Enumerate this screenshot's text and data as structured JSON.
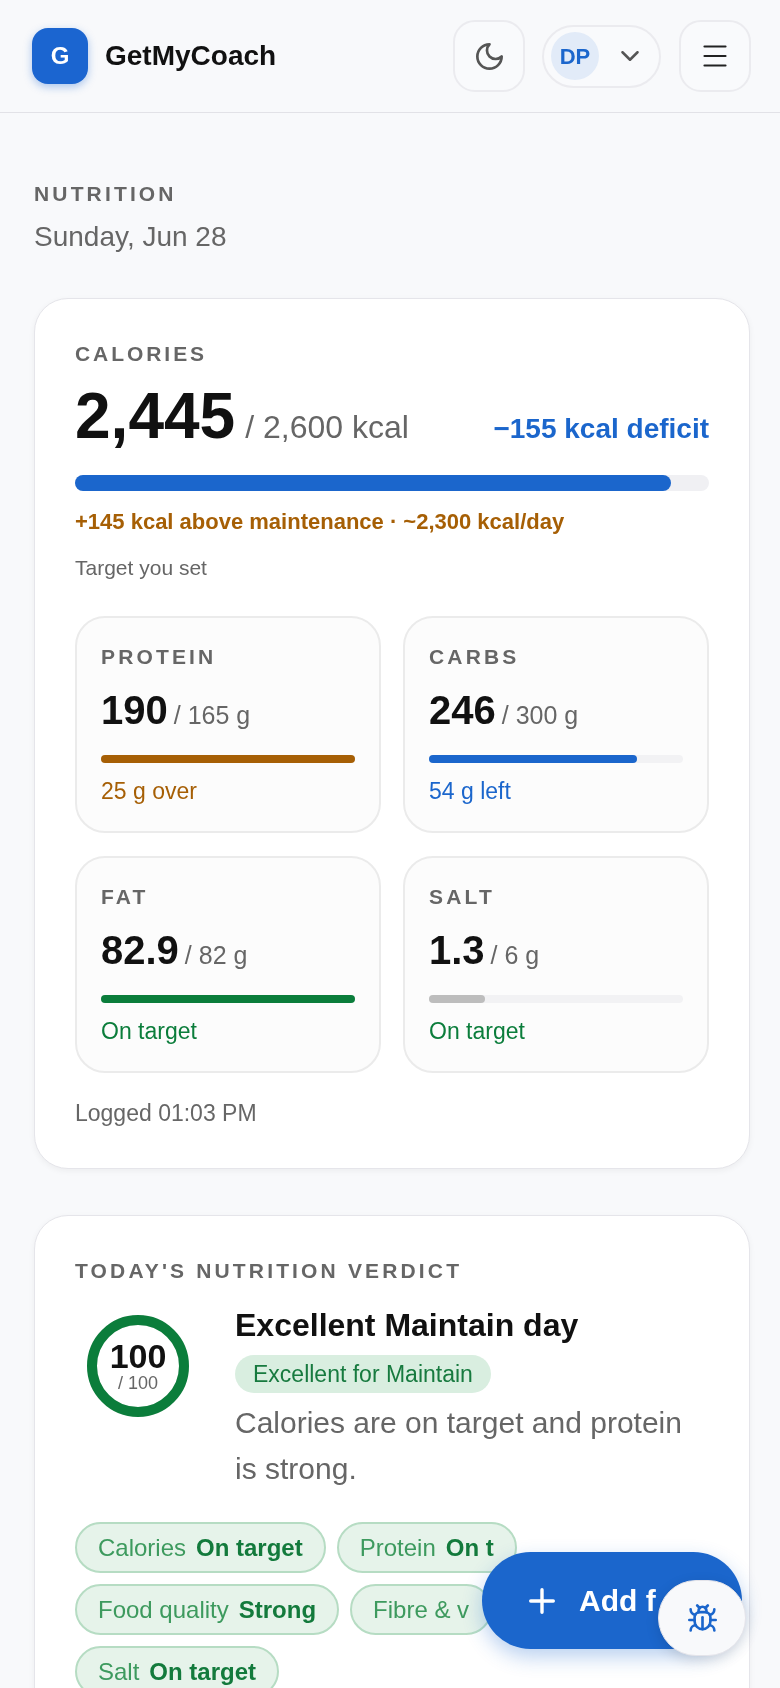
{
  "header": {
    "logo_letter": "G",
    "app_name": "GetMyCoach",
    "profile_initials": "DP"
  },
  "page": {
    "section": "NUTRITION",
    "date": "Sunday, Jun 28"
  },
  "calories": {
    "label": "CALORIES",
    "value": "2,445",
    "target": "/ 2,600 kcal",
    "balance": "−155 kcal deficit",
    "level": 0.94,
    "maintenance_note": "+145 kcal above maintenance · ~2,300 kcal/day",
    "target_note": "Target you set",
    "logged": "Logged 01:03 PM"
  },
  "macros": [
    {
      "label": "PROTEIN",
      "value": "190",
      "target": "/ 165 g",
      "bar": {
        "level": 1,
        "color": "#a65f05"
      },
      "status": {
        "text": "25 g over",
        "color": "#a65f05"
      }
    },
    {
      "label": "CARBS",
      "value": "246",
      "target": "/ 300 g",
      "bar": {
        "level": 0.82,
        "color": "#1b66cc"
      },
      "status": {
        "text": "54 g left",
        "color": "#1b66cc"
      }
    },
    {
      "label": "FAT",
      "value": "82.9",
      "target": "/ 82 g",
      "bar": {
        "level": 1,
        "color": "#0b7d3b"
      },
      "status": {
        "text": "On target",
        "color": "#0b7d3b"
      }
    },
    {
      "label": "SALT",
      "value": "1.3",
      "target": "/ 6 g",
      "bar": {
        "level": 0.22,
        "color": "#bdbdbd"
      },
      "status": {
        "text": "On target",
        "color": "#0b7d3b"
      }
    }
  ],
  "verdict": {
    "label": "TODAY'S NUTRITION VERDICT",
    "ring": {
      "value": "100",
      "max": "/ 100",
      "level": 1
    },
    "title": "Excellent Maintain day",
    "badge": "Excellent for Maintain",
    "summary": "Calories are on target and protein is strong.",
    "chips": [
      {
        "label": "Calories",
        "value": "On target"
      },
      {
        "label": "Protein",
        "value": "On t"
      },
      {
        "label": "Food quality",
        "value": "Strong"
      },
      {
        "label": "Fibre & v"
      },
      {
        "label": "Salt",
        "value": "On target"
      }
    ]
  },
  "add_button": {
    "label": "Add f"
  }
}
